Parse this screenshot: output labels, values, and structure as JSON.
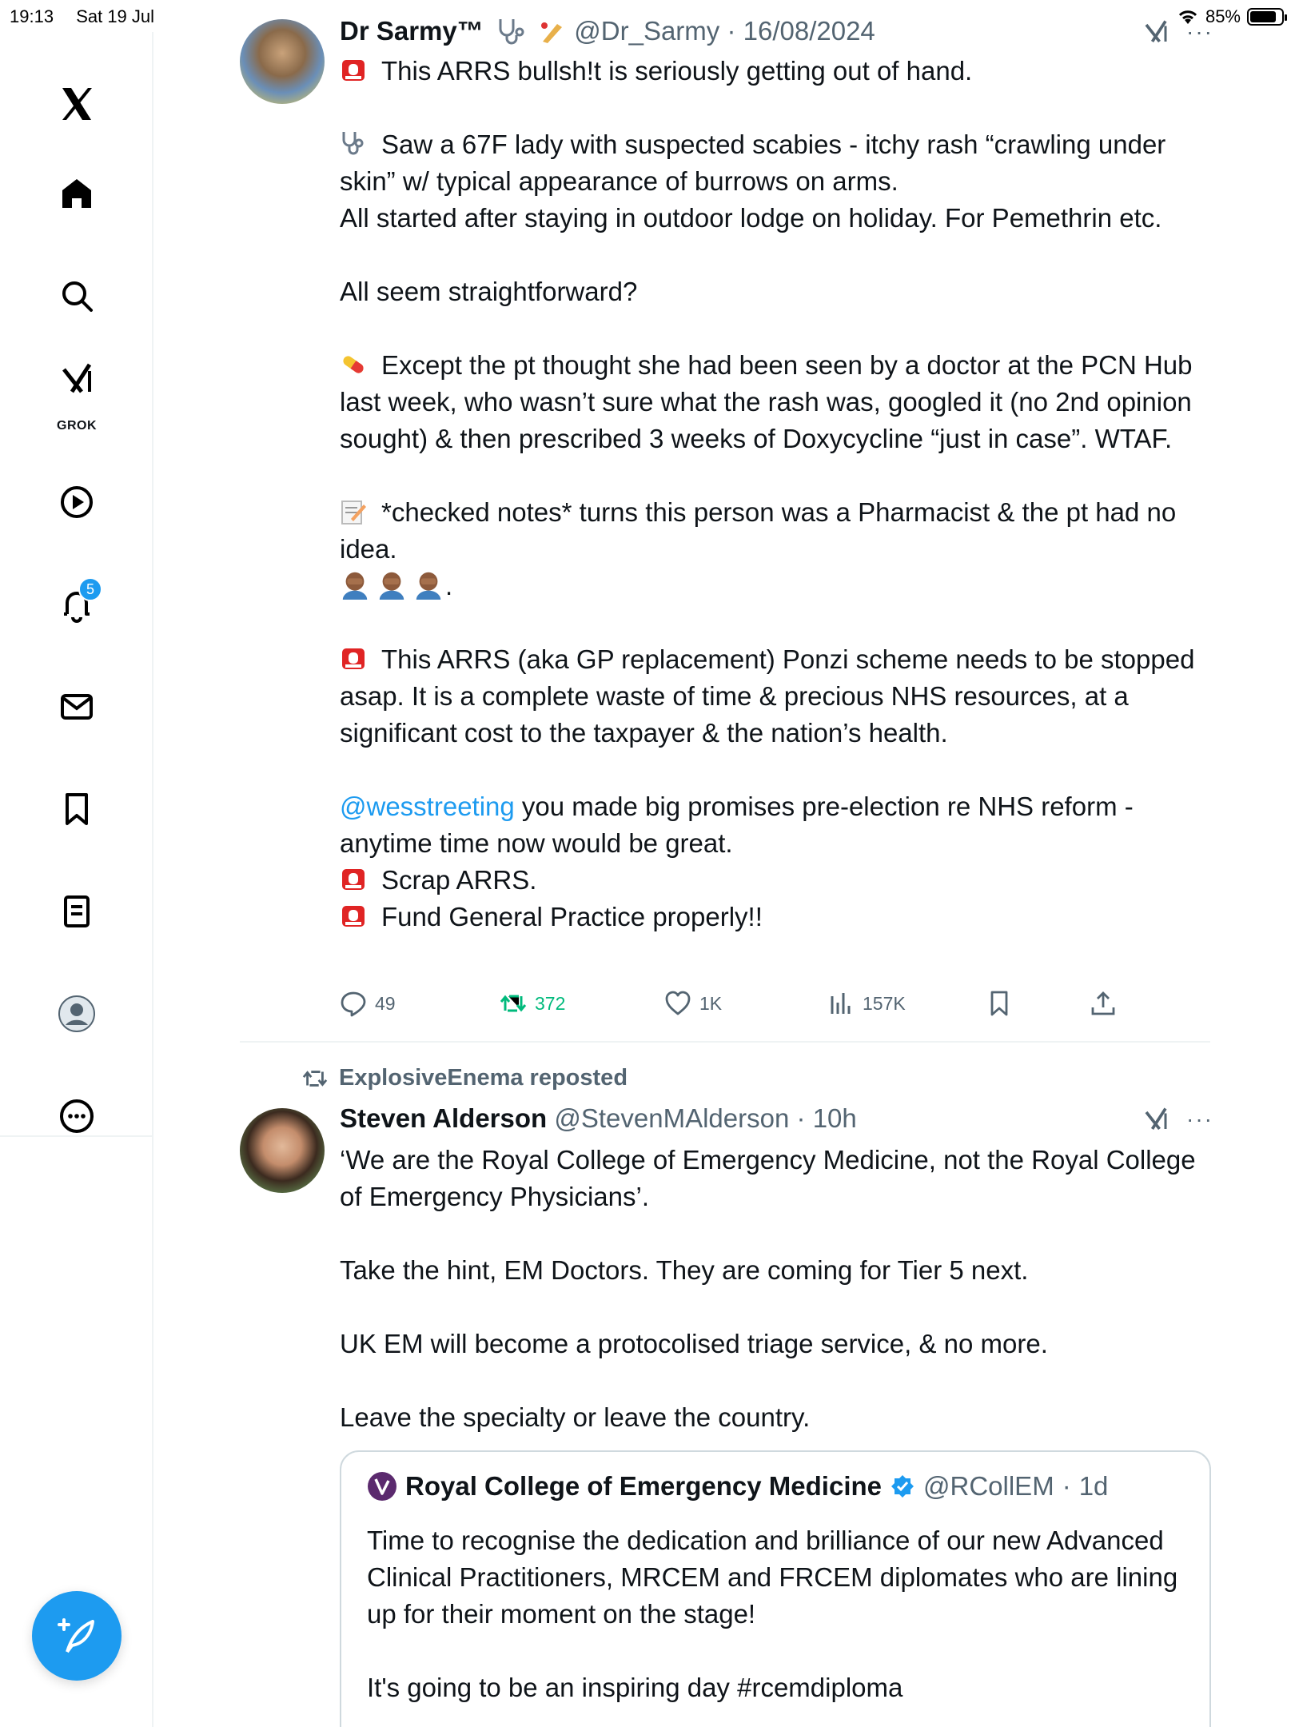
{
  "status_bar": {
    "time": "19:13",
    "date": "Sat 19 Jul",
    "battery": "85%",
    "battery_level": 0.85
  },
  "sidebar": {
    "grok_label": "GROK",
    "notifications_badge": "5",
    "items": [
      "x-logo",
      "home",
      "search",
      "grok",
      "video",
      "notifications",
      "messages",
      "bookmarks",
      "lists",
      "profile",
      "more"
    ]
  },
  "tweets": [
    {
      "name": "Dr Sarmy™",
      "handle": "@Dr_Sarmy",
      "separator": "·",
      "time": "16/08/2024",
      "line1": "This ARRS bullsh!t is seriously getting out of hand.",
      "p2a": "Saw a 67F lady with suspected scabies - itchy rash “crawling under skin” w/ typical appearance of burrows on arms.",
      "p2b": "All started after staying in outdoor lodge on holiday. For Pemethrin etc.",
      "p3": "All seem straightforward?",
      "p4": "Except the pt thought she had been seen by a doctor at the PCN Hub last week, who wasn’t sure what the rash was, googled it (no 2nd opinion sought) & then prescribed 3 weeks of Doxycycline “just in case”. WTAF.",
      "p5": "*checked notes* turns this person was a Pharmacist & the pt had no idea.",
      "p5_tail": ".",
      "p6": "This ARRS (aka GP replacement) Ponzi scheme needs to be stopped asap. It is a complete waste of time & precious NHS resources, at a significant cost to the taxpayer & the nation’s health.",
      "mention": "@wesstreeting",
      "p7": " you made big promises pre-election re NHS reform - anytime time now would be great.",
      "p8": "Scrap ARRS.",
      "p9": "Fund General Practice properly!!",
      "replies": "49",
      "reposts": "372",
      "likes": "1K",
      "views": "157K"
    },
    {
      "reposted_by": "ExplosiveEnema reposted",
      "name": "Steven Alderson",
      "handle": "@StevenMAlderson",
      "separator": "·",
      "time": "10h",
      "p1": "‘We are the Royal College of Emergency Medicine, not the Royal College of Emergency Physicians’.",
      "p2": "Take the hint, EM Doctors. They are coming for Tier 5 next.",
      "p3": "UK EM will become a protocolised triage service, & no more.",
      "p4": "Leave the specialty or leave the country.",
      "quote": {
        "name": "Royal College of Emergency Medicine",
        "handle": "@RCollEM",
        "separator": "·",
        "time": "1d",
        "p1": "Time to recognise the dedication and brilliance of our new Advanced Clinical Practitioners, MRCEM and FRCEM diplomates who are lining up for their moment on the stage!",
        "p2": "It's going to be an inspiring day #rcemdiploma"
      }
    }
  ],
  "colors": {
    "accent": "#1d9bf0",
    "repost_green": "#00ba7c",
    "muted": "#536471",
    "text": "#0f1419"
  }
}
